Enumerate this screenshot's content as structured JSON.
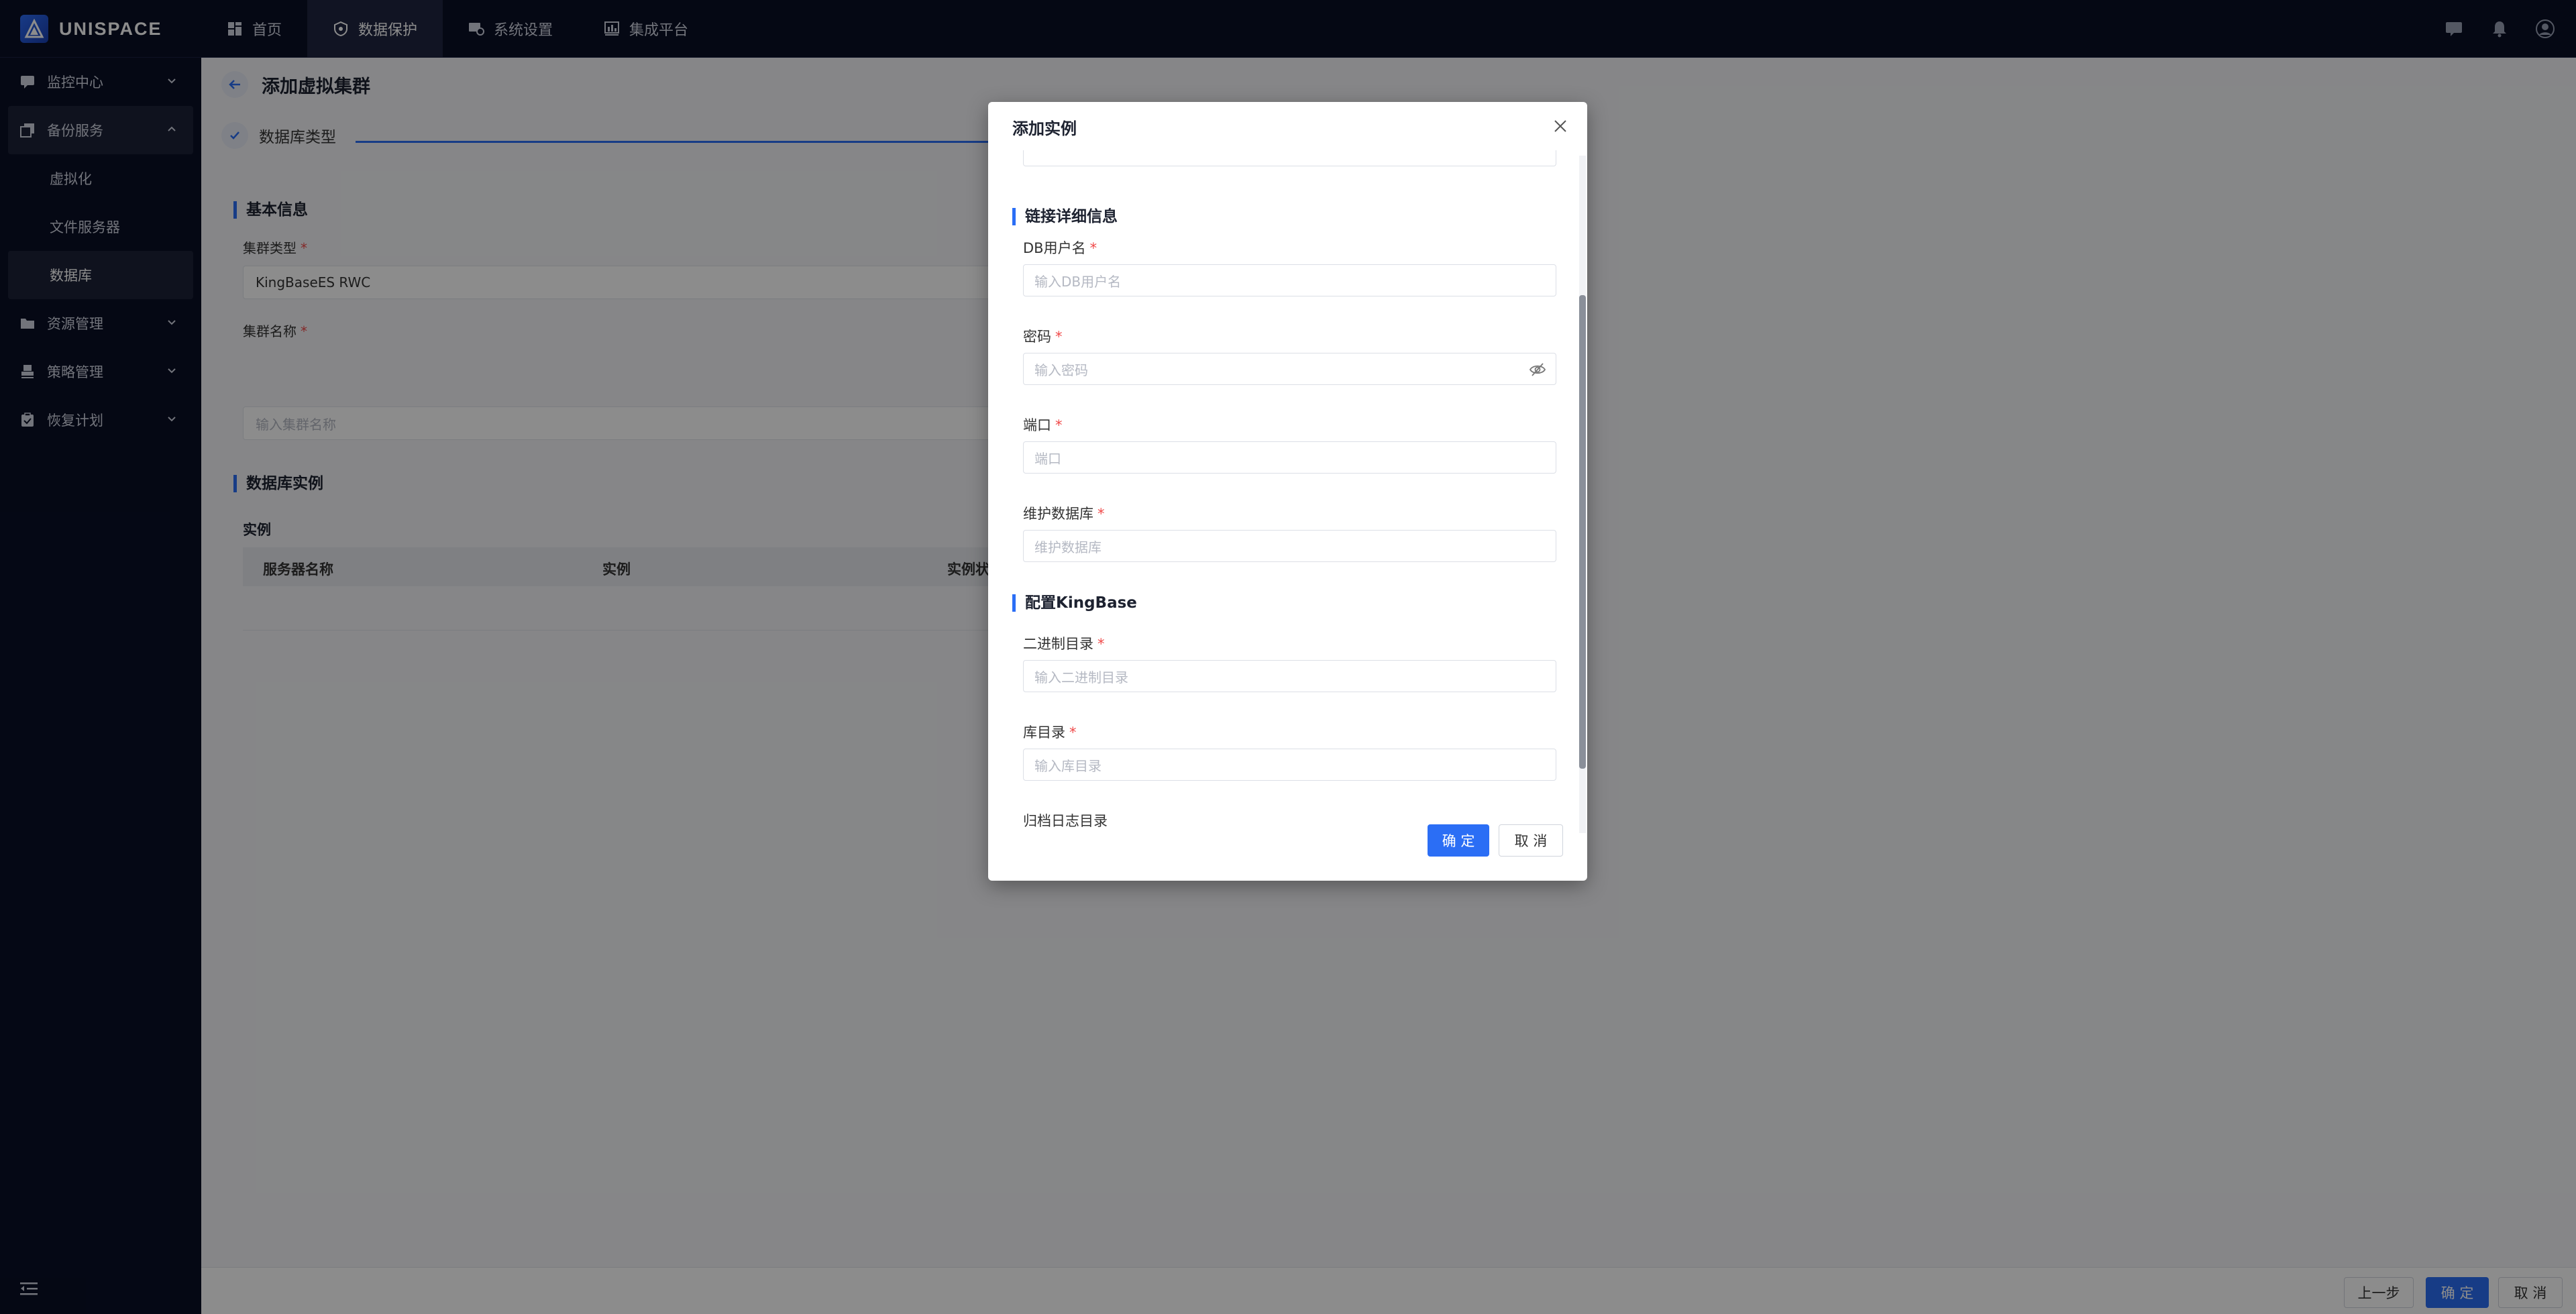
{
  "app": {
    "name": "UNISPACE"
  },
  "nav": {
    "items": [
      {
        "label": "首页",
        "icon": "dashboard-icon"
      },
      {
        "label": "数据保护",
        "icon": "shield-icon"
      },
      {
        "label": "系统设置",
        "icon": "settings-icon"
      },
      {
        "label": "集成平台",
        "icon": "chart-icon"
      }
    ]
  },
  "sidebar": {
    "items": [
      {
        "label": "监控中心"
      },
      {
        "label": "备份服务"
      },
      {
        "label": "资源管理"
      },
      {
        "label": "策略管理"
      },
      {
        "label": "恢复计划"
      }
    ],
    "sub_items": [
      {
        "label": "虚拟化"
      },
      {
        "label": "文件服务器"
      },
      {
        "label": "数据库"
      }
    ]
  },
  "page": {
    "title": "添加虚拟集群",
    "step_label": "数据库类型",
    "basic_info": "基本信息",
    "cluster_type_label": "集群类型",
    "cluster_type_value": "KingBaseES RWC",
    "cluster_name_label": "集群名称",
    "cluster_name_placeholder": "输入集群名称",
    "db_instance": "数据库实例",
    "instance_label": "实例",
    "table_headers": [
      "服务器名称",
      "实例",
      "实例状"
    ]
  },
  "bottom": {
    "prev": "上一步",
    "ok": "确 定",
    "cancel": "取 消"
  },
  "modal": {
    "title": "添加实例",
    "section_conn": "链接详细信息",
    "db_user_label": "DB用户名",
    "db_user_placeholder": "输入DB用户名",
    "password_label": "密码",
    "password_placeholder": "输入密码",
    "port_label": "端口",
    "port_placeholder": "端口",
    "maint_db_label": "维护数据库",
    "maint_db_placeholder": "维护数据库",
    "section_config": "配置KingBase",
    "bin_dir_label": "二进制目录",
    "bin_dir_placeholder": "输入二进制目录",
    "lib_dir_label": "库目录",
    "lib_dir_placeholder": "输入库目录",
    "archive_dir_label": "归档日志目录",
    "ok": "确 定",
    "cancel": "取 消"
  },
  "required_mark": "*"
}
